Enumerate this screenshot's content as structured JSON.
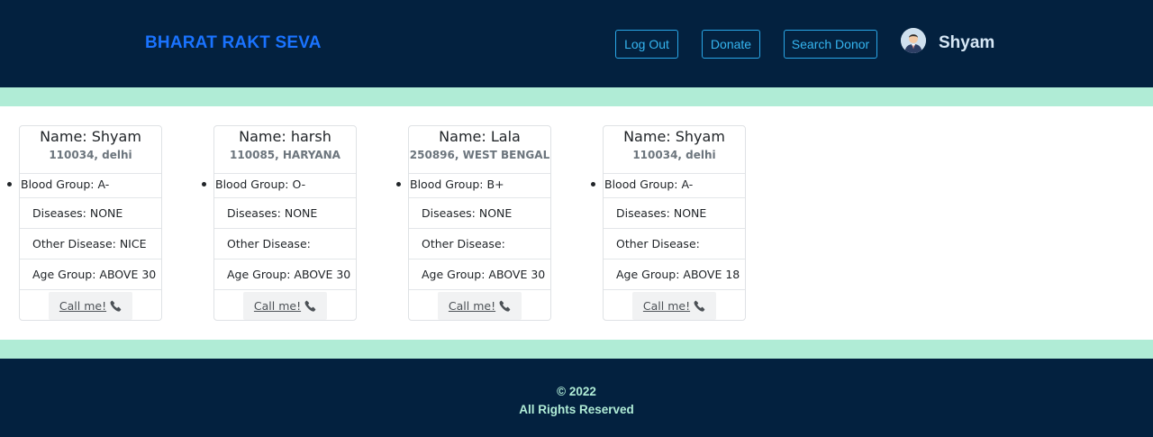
{
  "header": {
    "brand": "BHARAT RAKT SEVA",
    "nav": {
      "logout": "Log Out",
      "donate": "Donate",
      "search_donor": "Search Donor"
    },
    "user": {
      "name": "Shyam",
      "avatar_icon": "user-avatar-icon"
    }
  },
  "donors": [
    {
      "name": "Name: Shyam",
      "address": "110034, delhi",
      "blood_group": "Blood Group: A-",
      "diseases": "Diseases: NONE",
      "other_disease": "Other Disease: NICE",
      "age_group": "Age Group: ABOVE 30",
      "call_label": "Call me!"
    },
    {
      "name": "Name: harsh",
      "address": "110085, HARYANA",
      "blood_group": "Blood Group: O-",
      "diseases": "Diseases: NONE",
      "other_disease": "Other Disease:",
      "age_group": "Age Group: ABOVE 30",
      "call_label": "Call me!"
    },
    {
      "name": "Name: Lala",
      "address": "250896, WEST BENGAL",
      "blood_group": "Blood Group: B+",
      "diseases": "Diseases: NONE",
      "other_disease": "Other Disease:",
      "age_group": "Age Group: ABOVE 30",
      "call_label": "Call me!"
    },
    {
      "name": "Name: Shyam",
      "address": "110034, delhi",
      "blood_group": "Blood Group: A-",
      "diseases": "Diseases: NONE",
      "other_disease": "Other Disease:",
      "age_group": "Age Group: ABOVE 18",
      "call_label": "Call me!"
    }
  ],
  "footer": {
    "copyright": "© 2022",
    "rights": "All Rights Reserved"
  },
  "colors": {
    "header_bg": "#03213f",
    "brand": "#1a73ff",
    "nav_accent": "#35b5f0",
    "band": "#b0ecd6",
    "footer_text": "#b0ecd6"
  }
}
